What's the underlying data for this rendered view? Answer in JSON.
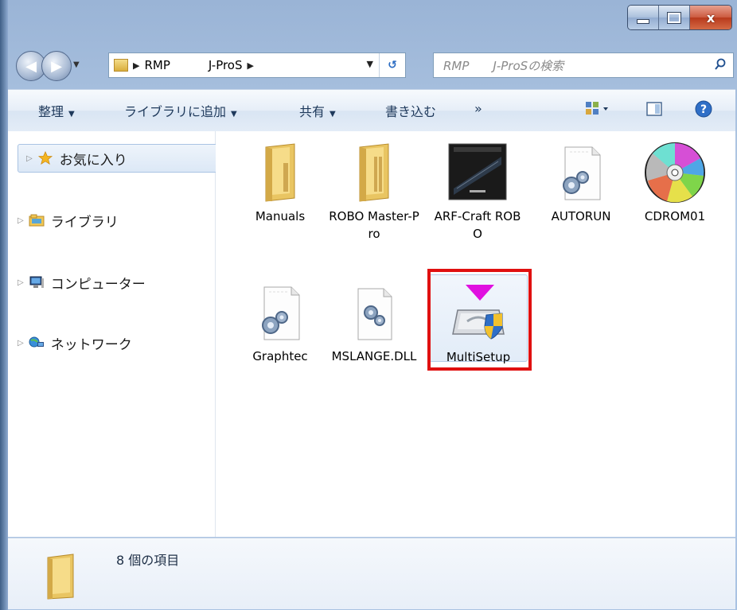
{
  "window": {
    "caption_buttons": {
      "minimize": "minimize",
      "maximize": "maximize",
      "close": "x"
    }
  },
  "address": {
    "segments": [
      "RMP",
      "J-ProS"
    ],
    "search_placeholder": "RMP　　J-ProSの検索"
  },
  "toolbar": {
    "organize": "整理",
    "add_to_library": "ライブラリに追加",
    "share": "共有",
    "burn": "書き込む",
    "more": "»"
  },
  "nav": {
    "favorites": "お気に入り",
    "libraries": "ライブラリ",
    "computer": "コンピューター",
    "network": "ネットワーク"
  },
  "files": [
    {
      "name": "Manuals",
      "type": "folder-icon"
    },
    {
      "name": "ROBO Master-Pro",
      "type": "folder-icon"
    },
    {
      "name": "ARF-Craft ROBO",
      "type": "image-thumbnail-icon"
    },
    {
      "name": "AUTORUN",
      "type": "settings-file-icon"
    },
    {
      "name": "CDROM01",
      "type": "cd-icon"
    },
    {
      "name": "Graphtec",
      "type": "settings-file-icon"
    },
    {
      "name": "MSLANGE.DLL",
      "type": "dll-file-icon"
    },
    {
      "name": "MultiSetup",
      "type": "setup-installer-icon"
    }
  ],
  "status": {
    "item_count": "8 個の項目"
  },
  "colors": {
    "highlight": "#e01010",
    "accent_arrow": "#e010e0"
  }
}
